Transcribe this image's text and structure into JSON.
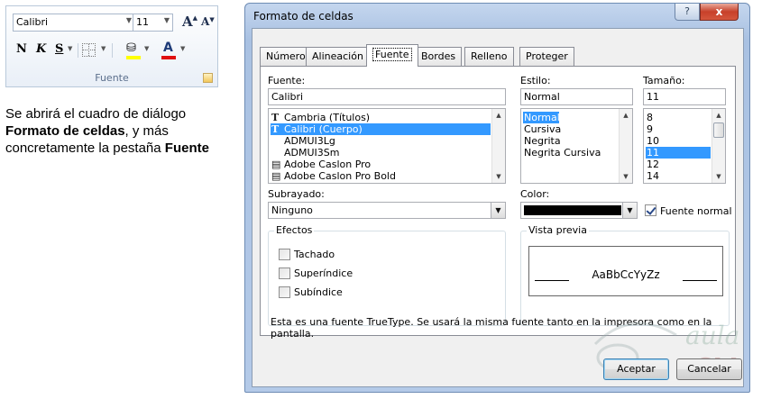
{
  "ribbon": {
    "font_name": "Calibri",
    "font_size": "11",
    "grow_label": "A",
    "shrink_label": "A",
    "bold_label": "N",
    "italic_label": "K",
    "underline_label": "S",
    "font_color_label": "A",
    "group_label": "Fuente",
    "fill_color": "#ffff00",
    "font_color": "#e01010"
  },
  "instruction": {
    "part1": "Se abrirá el cuadro de diálogo ",
    "bold1": "Formato de celdas",
    "part2": ", y más concretamente la pestaña ",
    "bold2": "Fuente"
  },
  "dialog": {
    "title": "Formato de celdas",
    "help_label": "?",
    "close_label": "x",
    "tabs": [
      {
        "label": "Número"
      },
      {
        "label": "Alineación"
      },
      {
        "label": "Fuente"
      },
      {
        "label": "Bordes"
      },
      {
        "label": "Relleno"
      },
      {
        "label": "Proteger"
      }
    ],
    "font": {
      "label": "Fuente:",
      "value": "Calibri",
      "items": [
        {
          "label": "Cambria (Títulos)",
          "icon": "truetype-icon"
        },
        {
          "label": "Calibri (Cuerpo)",
          "icon": "truetype-icon"
        },
        {
          "label": "ADMUI3Lg",
          "icon": ""
        },
        {
          "label": "ADMUI3Sm",
          "icon": ""
        },
        {
          "label": "Adobe Caslon Pro",
          "icon": "printer-font-icon"
        },
        {
          "label": "Adobe Caslon Pro Bold",
          "icon": "printer-font-icon"
        }
      ]
    },
    "style": {
      "label": "Estilo:",
      "value": "Normal",
      "items": [
        "Normal",
        "Cursiva",
        "Negrita",
        "Negrita Cursiva"
      ]
    },
    "size": {
      "label": "Tamaño:",
      "value": "11",
      "items": [
        "8",
        "9",
        "10",
        "11",
        "12",
        "14"
      ]
    },
    "underline": {
      "label": "Subrayado:",
      "value": "Ninguno"
    },
    "color": {
      "label": "Color:",
      "swatch": "#000000"
    },
    "normal_font": {
      "label": "Fuente normal",
      "checked": true
    },
    "effects": {
      "title": "Efectos",
      "items": [
        {
          "label": "Tachado",
          "checked": false
        },
        {
          "label": "Superíndice",
          "checked": false
        },
        {
          "label": "Subíndice",
          "checked": false
        }
      ]
    },
    "preview": {
      "title": "Vista previa",
      "sample": "AaBbCcYyZz"
    },
    "info": "Esta es una fuente TrueType. Se usará la misma fuente tanto en la impresora como en la pantalla.",
    "ok_label": "Aceptar",
    "cancel_label": "Cancelar"
  }
}
